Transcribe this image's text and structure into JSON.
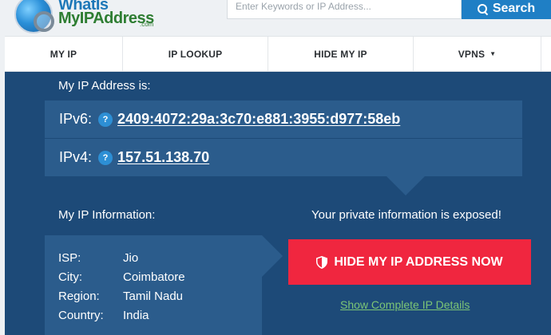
{
  "header": {
    "logo_line1": "WhatIs",
    "logo_line2": "MyIPAddress",
    "logo_suffix": ".com",
    "search_placeholder": "Enter Keywords or IP Address...",
    "search_button": "Search",
    "search_icon": "search-icon"
  },
  "nav": {
    "items": [
      {
        "label": "MY IP"
      },
      {
        "label": "IP LOOKUP"
      },
      {
        "label": "HIDE MY IP"
      },
      {
        "label": "VPNS",
        "icon": "chevron-down-icon"
      }
    ]
  },
  "ip": {
    "heading": "My IP Address is:",
    "ipv6_label": "IPv6:",
    "ipv6_value": "2409:4072:29a:3c70:e881:3955:d977:58eb",
    "ipv4_label": "IPv4:",
    "ipv4_value": "157.51.138.70",
    "help_glyph": "?"
  },
  "info": {
    "heading": "My IP Information:",
    "rows": [
      {
        "key": "ISP:",
        "value": "Jio"
      },
      {
        "key": "City:",
        "value": "Coimbatore"
      },
      {
        "key": "Region:",
        "value": "Tamil Nadu"
      },
      {
        "key": "Country:",
        "value": "India"
      }
    ]
  },
  "privacy": {
    "exposed_text": "Your private information is exposed!",
    "hide_button": "HIDE MY IP ADDRESS NOW",
    "details_link": "Show Complete IP Details"
  },
  "colors": {
    "panel": "#1d4a78",
    "row": "#2b5c8c",
    "accent_red": "#f0263f",
    "link_green": "#7cc576",
    "search_blue": "#1f7fc5"
  }
}
